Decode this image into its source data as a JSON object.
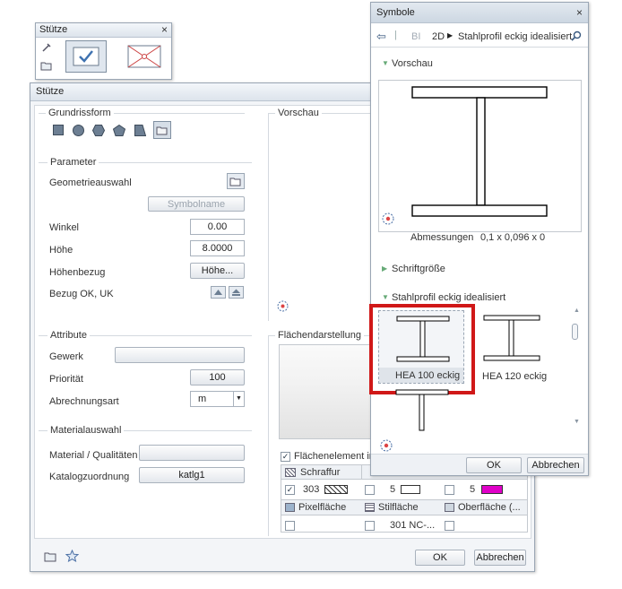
{
  "toolbar": {
    "title": "Stütze"
  },
  "dialog": {
    "title": "Stütze",
    "groups": {
      "grundriss": "Grundrissform",
      "vorschau": "Vorschau",
      "parameter": "Parameter",
      "attribute": "Attribute",
      "material": "Materialauswahl",
      "flaechen": "Flächendarstellung"
    },
    "parameter": {
      "geometrie_label": "Geometrieauswahl",
      "symbolname_btn": "Symbolname",
      "winkel_label": "Winkel",
      "winkel_value": "0.00",
      "hoehe_label": "Höhe",
      "hoehe_value": "8.0000",
      "hoehenbezug_label": "Höhenbezug",
      "hoehenbezug_btn": "Höhe...",
      "bezug_label": "Bezug OK, UK"
    },
    "attribute": {
      "gewerk_label": "Gewerk",
      "gewerk_value": "",
      "prioritaet_label": "Priorität",
      "prioritaet_value": "100",
      "abrechnung_label": "Abrechnungsart",
      "abrechnung_value": "m"
    },
    "material": {
      "qualitaet_label": "Material / Qualitäten",
      "qualitaet_value": "",
      "katalog_label": "Katalogzuordnung",
      "katalog_value": "katlg1"
    },
    "flaechen": {
      "element_label": "Flächenelement im G",
      "schraffur_label": "Schraffur",
      "schraffur_num": "303",
      "pen1": "5",
      "pen2": "5",
      "pixel_label": "Pixelfläche",
      "stil_label": "Stilfläche",
      "oberflaeche_label": "Oberfläche (...",
      "stil_value": "301 NC-..."
    },
    "ok": "OK",
    "cancel": "Abbrechen"
  },
  "symbole": {
    "title": "Symbole",
    "breadcrumb": [
      "BI",
      "2D",
      "Stahlprofil eckig idealisiert"
    ],
    "vorschau_label": "Vorschau",
    "abmessungen_label": "Abmessungen",
    "abmessungen_value": "0,1 x 0,096 x 0",
    "schriftgroesse_label": "Schriftgröße",
    "profile_section_label": "Stahlprofil eckig idealisiert",
    "items": [
      {
        "label": "HEA 100 eckig",
        "selected": true
      },
      {
        "label": "HEA 120 eckig",
        "selected": false
      }
    ],
    "ok": "OK",
    "cancel": "Abbrechen"
  },
  "colors": {
    "highlight": "#d01818",
    "magenta": "#e000c8",
    "accent": "#4a6fa5"
  }
}
